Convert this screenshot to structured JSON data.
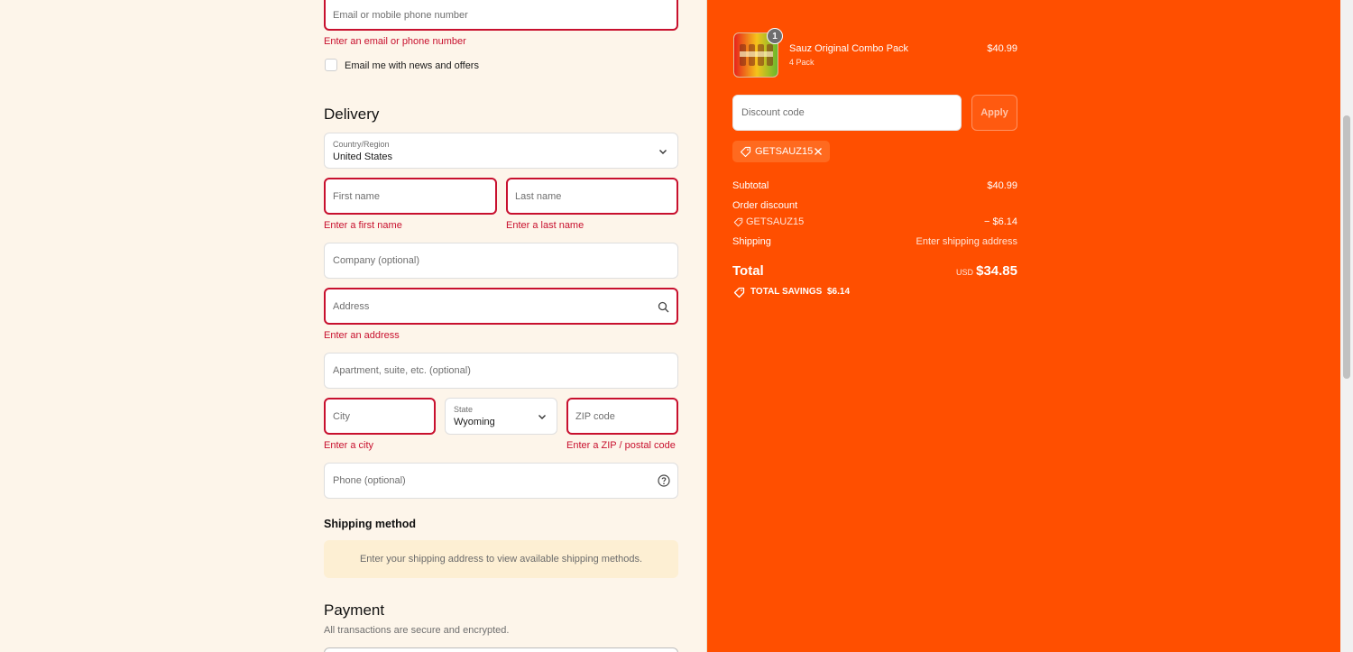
{
  "contact": {
    "email_placeholder": "Email or mobile phone number",
    "email_error": "Enter an email or phone number",
    "newsletter_label": "Email me with news and offers"
  },
  "delivery": {
    "heading": "Delivery",
    "country_label": "Country/Region",
    "country_value": "United States",
    "first_name_placeholder": "First name",
    "first_name_error": "Enter a first name",
    "last_name_placeholder": "Last name",
    "last_name_error": "Enter a last name",
    "company_placeholder": "Company (optional)",
    "address_placeholder": "Address",
    "address_error": "Enter an address",
    "apartment_placeholder": "Apartment, suite, etc. (optional)",
    "city_placeholder": "City",
    "city_error": "Enter a city",
    "state_label": "State",
    "state_value": "Wyoming",
    "zip_placeholder": "ZIP code",
    "zip_error": "Enter a ZIP / postal code",
    "phone_placeholder": "Phone (optional)"
  },
  "shipping": {
    "heading": "Shipping method",
    "notice": "Enter your shipping address to view available shipping methods."
  },
  "payment": {
    "heading": "Payment",
    "subtitle": "All transactions are secure and encrypted."
  },
  "summary": {
    "item": {
      "name": "Sauz Original Combo Pack",
      "variant": "4 Pack",
      "price": "$40.99",
      "quantity": "1"
    },
    "discount_placeholder": "Discount code",
    "apply_label": "Apply",
    "applied_code": "GETSAUZ15",
    "subtotal_label": "Subtotal",
    "subtotal_value": "$40.99",
    "order_discount_label": "Order discount",
    "order_discount_code": "GETSAUZ15",
    "order_discount_value": "− $6.14",
    "shipping_label": "Shipping",
    "shipping_value": "Enter shipping address",
    "total_label": "Total",
    "currency": "USD",
    "total_value": "$34.85",
    "savings_label": "TOTAL SAVINGS",
    "savings_value": "$6.14"
  },
  "colors": {
    "panel": "#ff4f00",
    "error": "#c8102e",
    "page_bg": "#fdf5ea"
  }
}
